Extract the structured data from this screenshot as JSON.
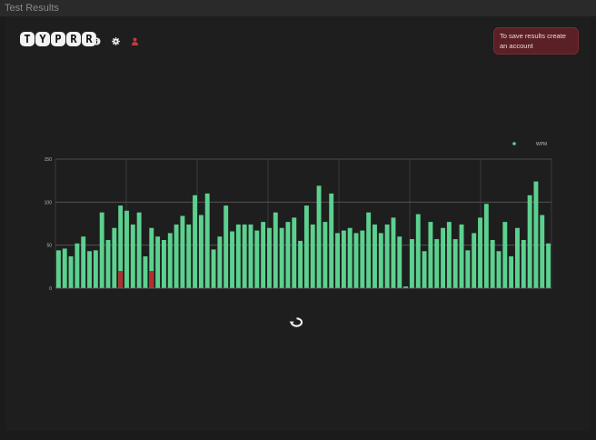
{
  "window": {
    "title": "Test Results"
  },
  "header": {
    "logo_letters": [
      "T",
      "Y",
      "P",
      "R",
      "R"
    ],
    "icons": [
      "info-icon",
      "gear-icon",
      "user-icon"
    ]
  },
  "toast": {
    "message": "To save results create an account"
  },
  "controls": {
    "restart_icon": "restart-icon"
  },
  "colors": {
    "bar": "#5cd18f",
    "error": "#b1302f",
    "background": "#1e1e1e"
  },
  "chart_data": {
    "type": "bar",
    "legend": "WPM",
    "legend_position": "top-right",
    "ylim": [
      0,
      150
    ],
    "yticks": [
      "0",
      "50",
      "100",
      "150"
    ],
    "grid": true,
    "series": [
      {
        "name": "WPM",
        "values": [
          44,
          46,
          37,
          52,
          60,
          43,
          44,
          88,
          56,
          70,
          96,
          90,
          74,
          88,
          37,
          70,
          60,
          56,
          64,
          74,
          84,
          74,
          108,
          85,
          110,
          45,
          60,
          96,
          66,
          74,
          74,
          74,
          67,
          77,
          70,
          88,
          70,
          77,
          82,
          55,
          96,
          74,
          119,
          77,
          110,
          64,
          67,
          70,
          64,
          67,
          88,
          74,
          64,
          74,
          82,
          60,
          2,
          57,
          86,
          43,
          77,
          57,
          70,
          77,
          57,
          74,
          44,
          64,
          82,
          98,
          56,
          43,
          77,
          37,
          70,
          56,
          108,
          124,
          85,
          52
        ]
      },
      {
        "name": "errors",
        "values": [
          0,
          0,
          0,
          0,
          0,
          0,
          0,
          0,
          0,
          20,
          0,
          0,
          0,
          0,
          0,
          0,
          0,
          0,
          0,
          0,
          0,
          0,
          0,
          0,
          0,
          0,
          0,
          0,
          0,
          0,
          0,
          0,
          0,
          0,
          0,
          0,
          0,
          0,
          0,
          0,
          0,
          0,
          0,
          0,
          0,
          0,
          0,
          0,
          0,
          0,
          0,
          0,
          0,
          0,
          0,
          0,
          0,
          0,
          0,
          0,
          0,
          0,
          0,
          0,
          0,
          0,
          0,
          0,
          0,
          0,
          0,
          0,
          0,
          0,
          0,
          0,
          0,
          0,
          0,
          0
        ]
      }
    ],
    "error_indices": [
      10,
      15
    ]
  }
}
